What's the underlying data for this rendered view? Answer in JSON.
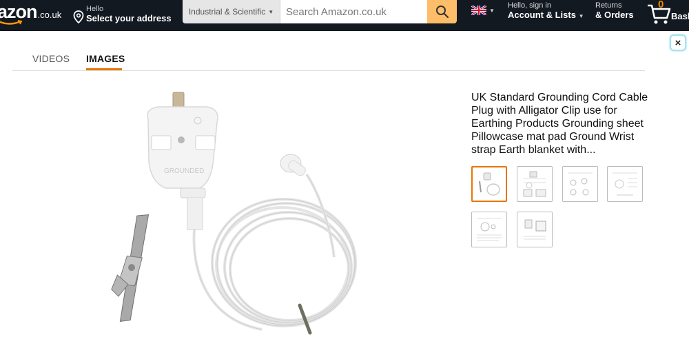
{
  "header": {
    "logo_text": "azon",
    "logo_tld": ".co.uk",
    "address": {
      "hello": "Hello",
      "label": "Select your address"
    },
    "search": {
      "category": "Industrial & Scientific",
      "placeholder": "Search Amazon.co.uk"
    },
    "account": {
      "hello": "Hello, sign in",
      "label": "Account & Lists"
    },
    "returns": {
      "top": "Returns",
      "label": "& Orders"
    },
    "basket": {
      "count": "0",
      "label": "Basket"
    }
  },
  "modal": {
    "close_label": "×",
    "tabs": [
      {
        "label": "VIDEOS",
        "active": false
      },
      {
        "label": "IMAGES",
        "active": true
      }
    ],
    "product_title": "UK Standard Grounding Cord Cable Plug with Alligator Clip use for Earthing Products Grounding sheet Pillowcase mat pad Ground Wrist strap Earth blanket with...",
    "thumbnails_count": 6,
    "selected_thumbnail": 1
  },
  "colors": {
    "header_bg": "#131921",
    "search_button": "#febd69",
    "accent_orange": "#e77600",
    "basket_count": "#f08804"
  }
}
